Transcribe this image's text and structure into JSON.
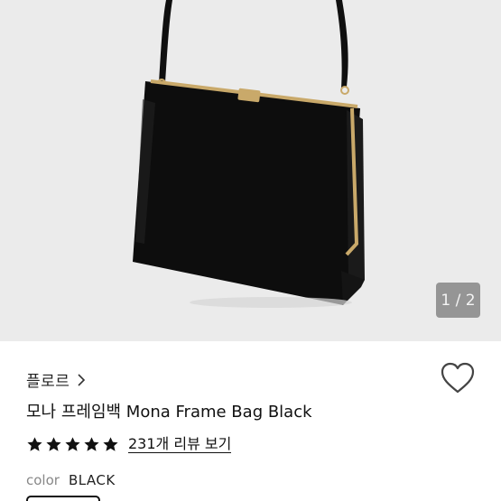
{
  "gallery": {
    "counter": "1 / 2",
    "image_alt": "black frame bag product photo"
  },
  "product": {
    "brand": "플로르",
    "title": "모나 프레임백 Mona Frame Bag Black",
    "rating": 5,
    "rating_max": 5,
    "review_link": "231개 리뷰 보기",
    "option_label": "color",
    "option_value": "BLACK"
  },
  "colors": {
    "hero_bg": "#ebebeb",
    "bag": "#0d0d0d",
    "hardware": "#c9a96a"
  },
  "icons": {
    "brand_chevron": "chevron-right-icon",
    "wishlist": "heart-icon",
    "rating": "star-icon"
  }
}
